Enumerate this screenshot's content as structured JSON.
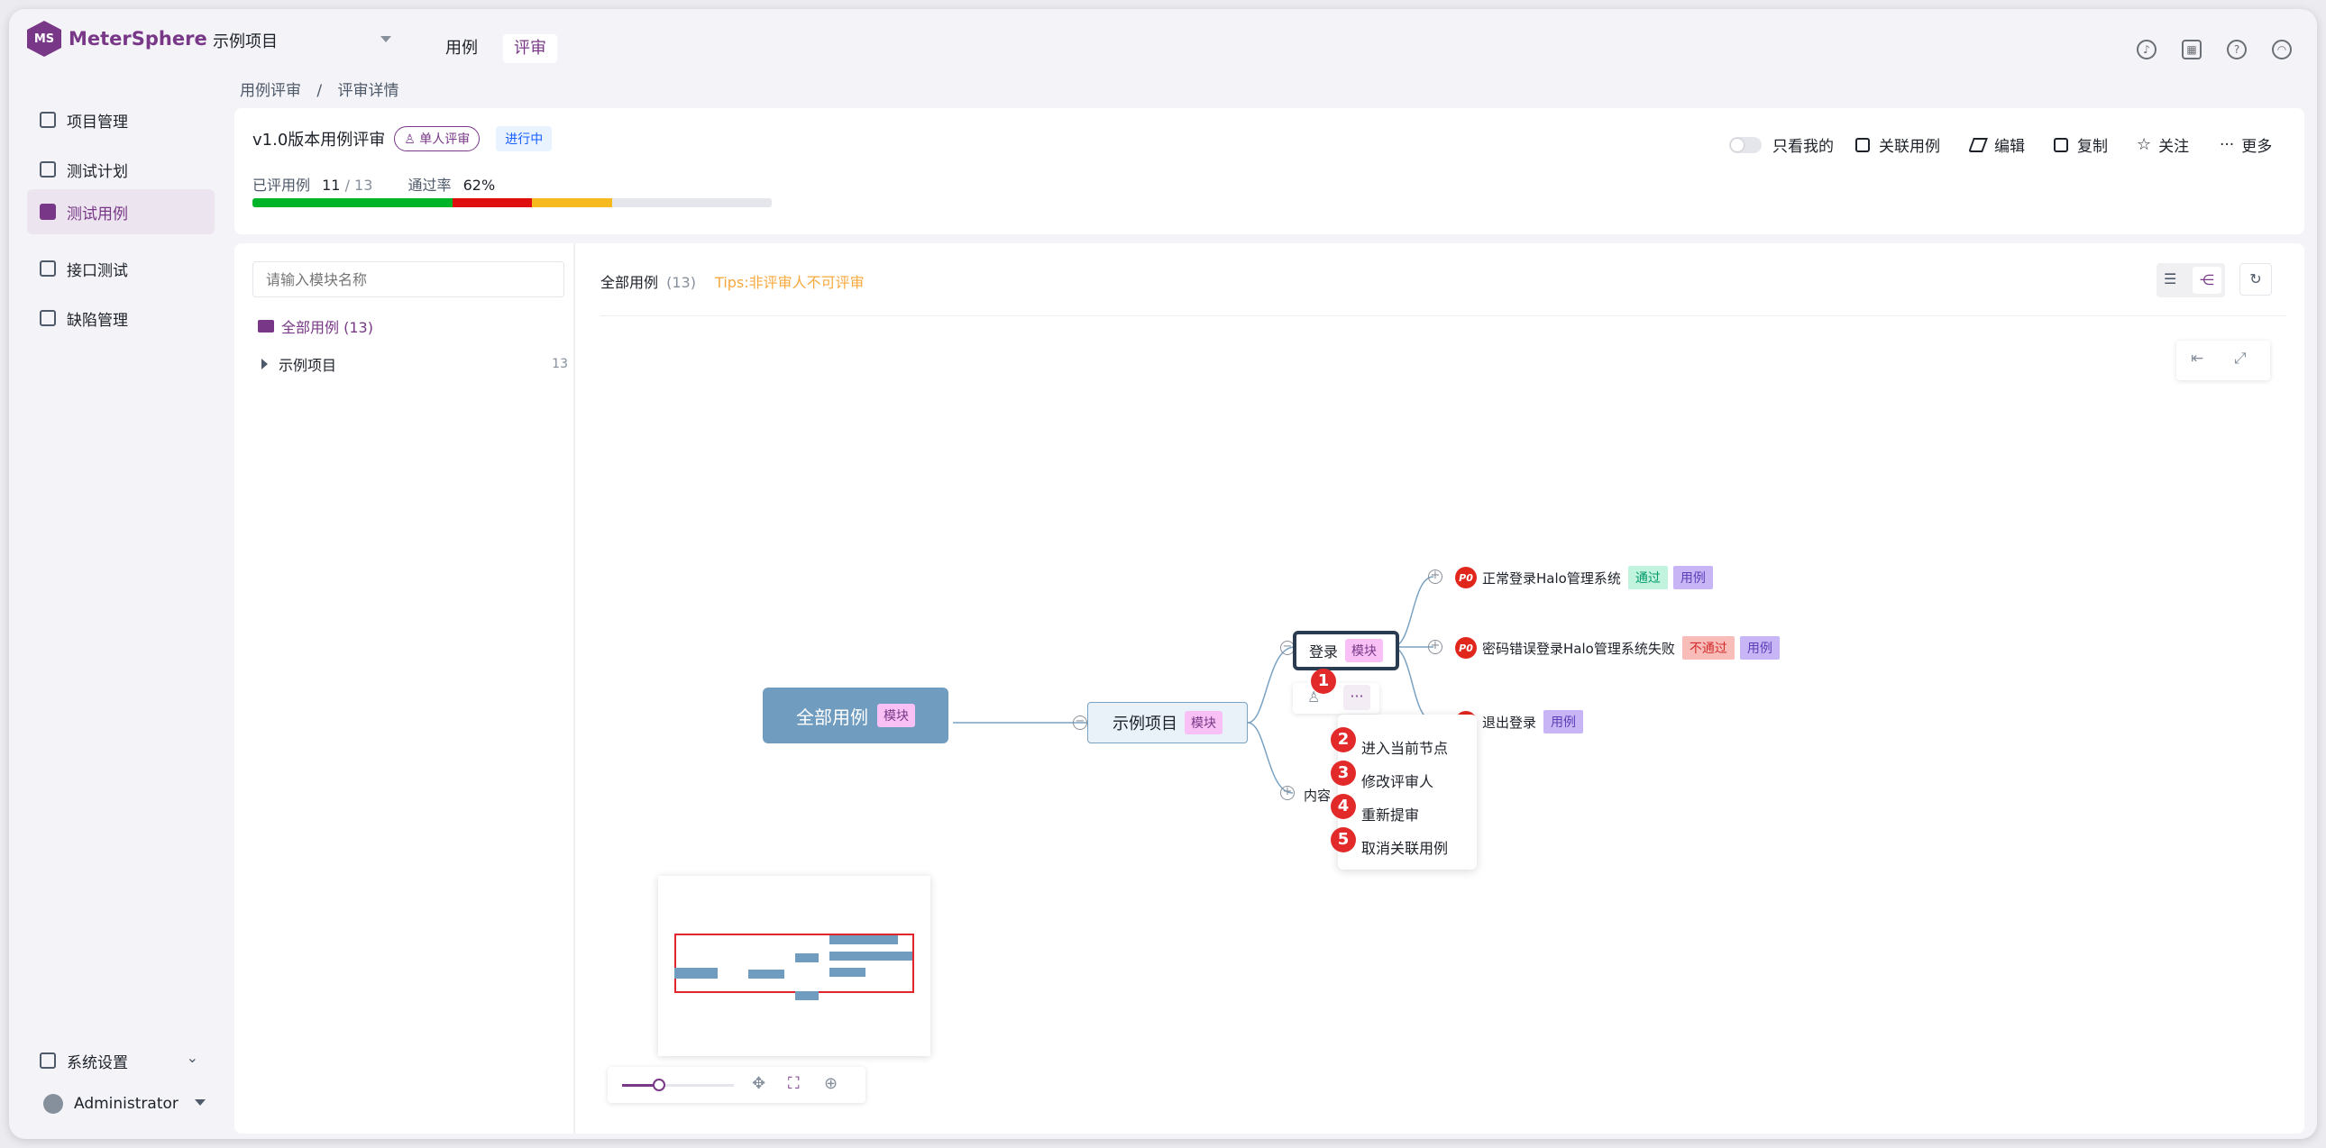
{
  "app": {
    "name": "MeterSphere",
    "logo_letters": "MS"
  },
  "project_select": {
    "value": "示例项目"
  },
  "topnav": [
    {
      "label": "用例"
    },
    {
      "label": "评审"
    }
  ],
  "top_icons": [
    "bell-icon",
    "calendar-icon",
    "help-icon",
    "user-circle-icon"
  ],
  "sidebar": {
    "items": [
      {
        "label": "项目管理",
        "icon": "project-icon"
      },
      {
        "label": "测试计划",
        "icon": "plan-icon"
      },
      {
        "label": "测试用例",
        "icon": "case-icon"
      },
      {
        "label": "接口测试",
        "icon": "api-icon"
      },
      {
        "label": "缺陷管理",
        "icon": "bug-icon"
      }
    ],
    "settings_label": "系统设置",
    "user_label": "Administrator"
  },
  "breadcrumb": {
    "parent": "用例评审",
    "sep": "/",
    "current": "评审详情"
  },
  "review": {
    "title": "v1.0版本用例评审",
    "mode_tag": "单人评审",
    "status_tag": "进行中",
    "reviewed_label": "已评用例",
    "reviewed_value": "11",
    "reviewed_total": "/ 13",
    "pass_rate_label": "通过率",
    "pass_rate_value": "62%",
    "progress": {
      "pass": 5,
      "fail": 2,
      "pending": 2,
      "unreviewed": 4,
      "total": 13
    },
    "colors": {
      "pass": "#00b42a",
      "fail": "#e00f0f",
      "pending": "#f7ba1e",
      "unreviewed": "#e5e6eb"
    }
  },
  "actions": {
    "only_mine": "只看我的",
    "link_case": "关联用例",
    "edit": "编辑",
    "copy": "复制",
    "follow": "关注",
    "more": "更多"
  },
  "tree": {
    "search_placeholder": "请输入模块名称",
    "all_label": "全部用例 (13)",
    "project_label": "示例项目",
    "project_count": "13"
  },
  "panel": {
    "title": "全部用例",
    "count": "(13)",
    "tips": "Tips:非评审人不可评审"
  },
  "mindmap": {
    "root": {
      "label": "全部用例",
      "tag": "模块"
    },
    "project": {
      "label": "示例项目",
      "tag": "模块"
    },
    "login": {
      "label": "登录",
      "tag": "模块"
    },
    "content": {
      "label": "内容"
    },
    "leaf1": {
      "priority": "P0",
      "label": "正常登录Halo管理系统",
      "status": "通过",
      "tag": "用例"
    },
    "leaf2": {
      "priority": "P0",
      "label": "密码错误登录Halo管理系统失败",
      "status": "不通过",
      "tag": "用例"
    },
    "leaf3": {
      "priority": "P0",
      "label": "退出登录",
      "tag": "用例"
    }
  },
  "context_menu": {
    "items": [
      {
        "num": "2",
        "label": "进入当前节点"
      },
      {
        "num": "3",
        "label": "修改评审人"
      },
      {
        "num": "4",
        "label": "重新提审"
      },
      {
        "num": "5",
        "label": "取消关联用例"
      }
    ]
  },
  "badges": {
    "one": "1"
  },
  "more_glyph": "···"
}
